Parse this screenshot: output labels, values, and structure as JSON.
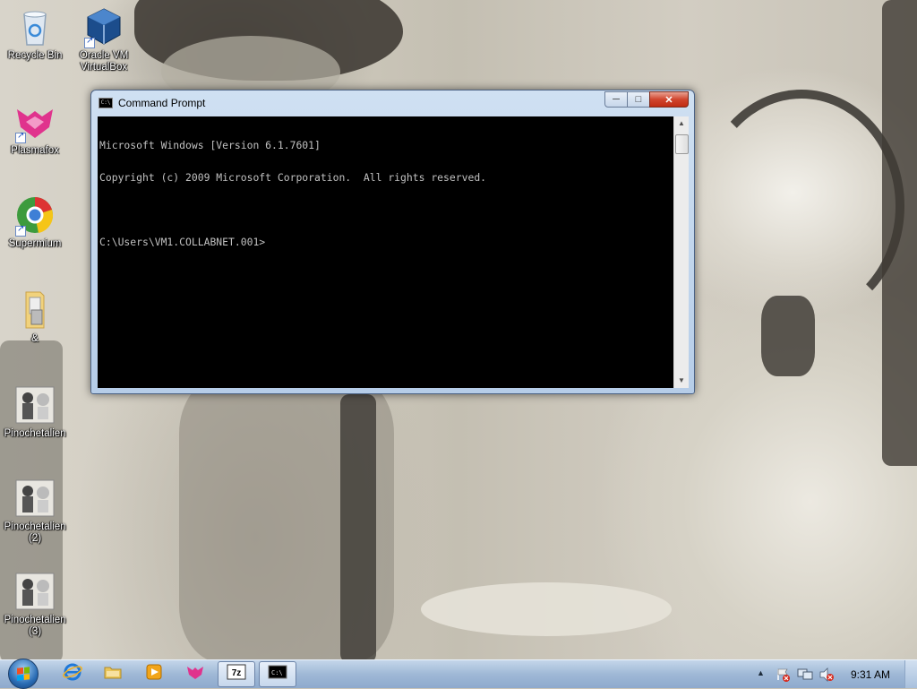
{
  "desktop": {
    "icons": [
      {
        "label": "Recycle Bin",
        "icon": "recycle-bin-icon"
      },
      {
        "label": "Oracle VM VirtualBox",
        "icon": "virtualbox-icon"
      },
      {
        "label": "Plasmafox",
        "icon": "plasmafox-icon"
      },
      {
        "label": "Supermium",
        "icon": "supermium-icon"
      },
      {
        "label": "&",
        "icon": "folder-icon"
      },
      {
        "label": "Pinochetalien",
        "icon": "image-thumbnail-icon"
      },
      {
        "label": "Pinochetalien (2)",
        "icon": "image-thumbnail-icon"
      },
      {
        "label": "Pinochetalien (3)",
        "icon": "image-thumbnail-icon"
      }
    ]
  },
  "window": {
    "title": "Command Prompt",
    "icon": "cmd-icon",
    "buttons": {
      "minimize": "minimize-icon",
      "maximize": "maximize-icon",
      "close": "close-icon"
    },
    "console_lines": [
      "Microsoft Windows [Version 6.1.7601]",
      "Copyright (c) 2009 Microsoft Corporation.  All rights reserved.",
      "",
      "C:\\Users\\VM1.COLLABNET.001>"
    ]
  },
  "taskbar": {
    "pinned": [
      {
        "name": "internet-explorer-icon"
      },
      {
        "name": "file-explorer-icon"
      },
      {
        "name": "media-player-icon"
      },
      {
        "name": "plasmafox-icon"
      },
      {
        "name": "7zip-icon"
      },
      {
        "name": "cmd-icon"
      }
    ],
    "active_item": "cmd-icon",
    "tray_icons": [
      "show-hidden-icons-icon",
      "action-center-icon",
      "network-icon",
      "volume-icon"
    ],
    "clock": "9:31 AM"
  },
  "colors": {
    "console_bg": "#000000",
    "console_fg": "#c0c0c0",
    "taskbar": "#9fb8d6"
  }
}
